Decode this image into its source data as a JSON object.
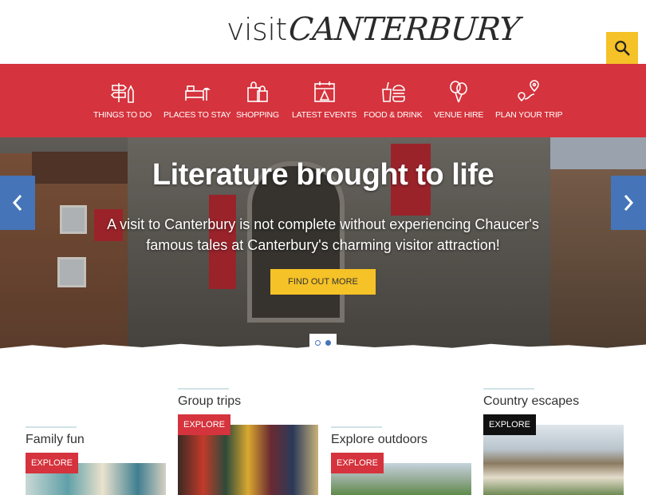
{
  "header": {
    "logo_visit": "visit",
    "logo_city": "CANTERBURY",
    "search_icon": "search-icon"
  },
  "nav": {
    "items": [
      {
        "label": "THINGS TO DO",
        "icon": "signpost-icon"
      },
      {
        "label": "PLACES TO STAY",
        "icon": "bed-icon"
      },
      {
        "label": "SHOPPING",
        "icon": "shopping-bags-icon"
      },
      {
        "label": "LATEST EVENTS",
        "icon": "calendar-icon"
      },
      {
        "label": "FOOD & DRINK",
        "icon": "burger-icon"
      },
      {
        "label": "VENUE HIRE",
        "icon": "balloons-icon"
      },
      {
        "label": "PLAN YOUR TRIP",
        "icon": "map-pin-icon"
      }
    ]
  },
  "hero": {
    "title": "Literature brought to life",
    "text": "A visit to Canterbury is not complete without experiencing Chaucer's famous tales at Canterbury's charming visitor attraction!",
    "cta": "FIND OUT MORE",
    "slides_total": 2,
    "active_slide": 2
  },
  "cards": [
    {
      "title": "Family fun",
      "button": "EXPLORE"
    },
    {
      "title": "Group trips",
      "button": "EXPLORE"
    },
    {
      "title": "Explore outdoors",
      "button": "EXPLORE"
    },
    {
      "title": "Country escapes",
      "button": "EXPLORE"
    }
  ],
  "colors": {
    "brand_red": "#d5333d",
    "accent_yellow": "#f5c227",
    "arrow_blue": "#4575b8"
  }
}
